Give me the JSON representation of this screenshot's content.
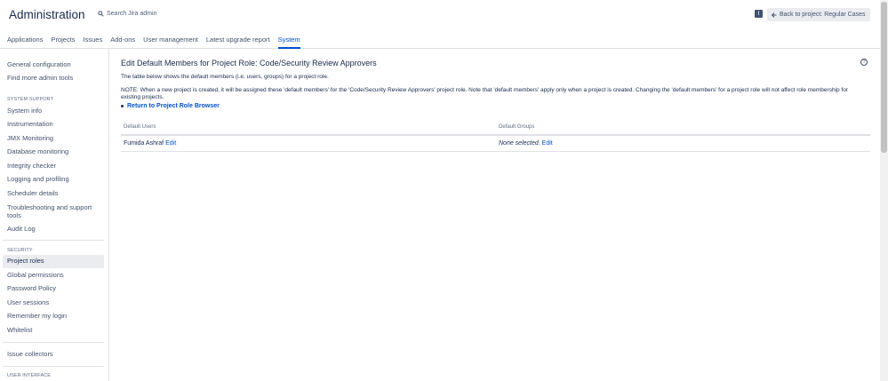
{
  "header": {
    "title": "Administration",
    "search_placeholder": "Search Jira admin",
    "back_label": "Back to project: Regular Cases",
    "help_glyph": "!"
  },
  "tabs": [
    {
      "label": "Applications"
    },
    {
      "label": "Projects"
    },
    {
      "label": "Issues"
    },
    {
      "label": "Add-ons"
    },
    {
      "label": "User management"
    },
    {
      "label": "Latest upgrade report"
    },
    {
      "label": "System",
      "active": true
    }
  ],
  "sidebar": {
    "top_items": [
      "General configuration",
      "Find more admin tools"
    ],
    "system_support_heading": "SYSTEM SUPPORT",
    "system_support_items": [
      "System info",
      "Instrumentation",
      "JMX Monitoring",
      "Database monitoring",
      "Integrity checker",
      "Logging and profiling",
      "Scheduler details",
      "Troubleshooting and support tools",
      "Audit Log"
    ],
    "security_heading": "SECURITY",
    "security_items": [
      "Project roles",
      "Global permissions",
      "Password Policy",
      "User sessions",
      "Remember my login",
      "Whitelist"
    ],
    "other_items": [
      "Issue collectors"
    ],
    "ui_heading": "USER INTERFACE",
    "selected": "Project roles"
  },
  "main": {
    "title": "Edit Default Members for Project Role: Code/Security Review Approvers",
    "help_glyph": "?",
    "description": "The table below shows the default members (i.e. users, groups) for a project role.",
    "note": "NOTE: When a new project is created, it will be assigned these 'default members' for the 'Code/Security Review Approvers' project role. Note that 'default members' apply only when a project is created. Changing the 'default members' for a project role will not affect role membership for existing projects.",
    "return_link": "Return to Project Role Browser",
    "table": {
      "col_users": "Default Users",
      "col_groups": "Default Groups",
      "user_value": "Fumida Ashraf",
      "user_edit": "Edit",
      "groups_value": "None selected.",
      "groups_edit": "Edit"
    }
  }
}
